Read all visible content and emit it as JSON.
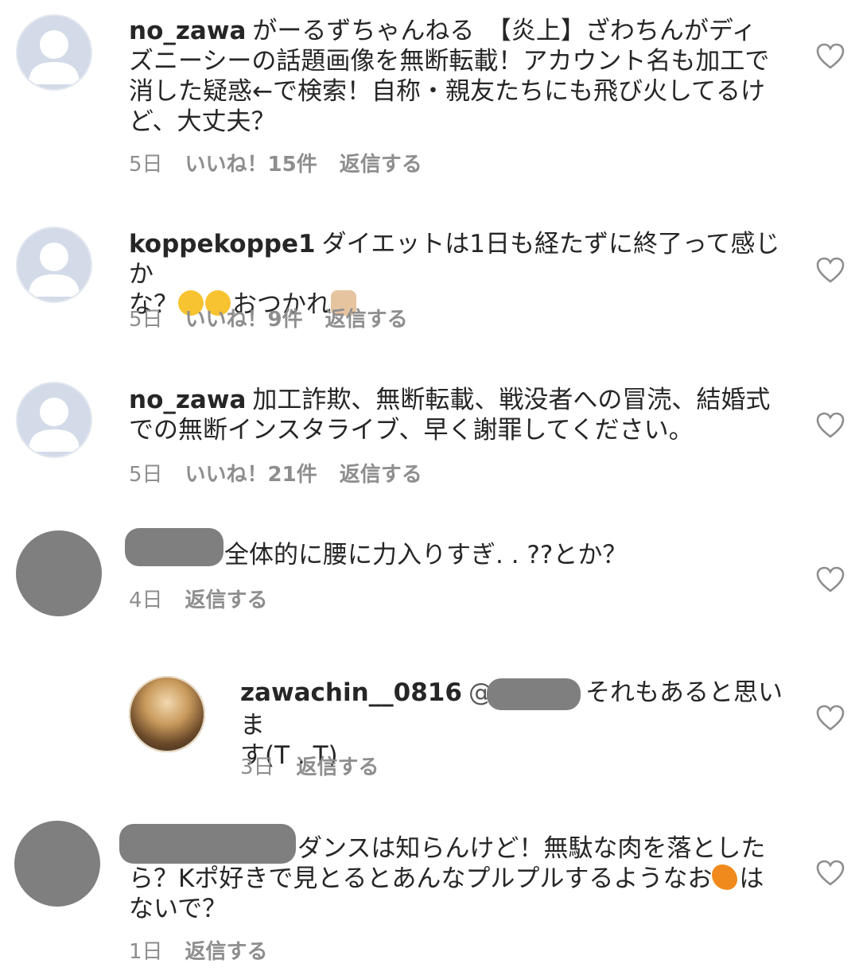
{
  "comments": [
    {
      "username": "no_zawa",
      "text_line1": "がーるずちゃんねる　【炎上】ざわちんがディ",
      "text_line2": "ズニーシーの話題画像を無断転載！アカウント名も加工で",
      "text_line3": "消した疑惑←で検索！自称・親友たちにも飛び火してるけ",
      "text_line4": "ど、大丈夫？",
      "time": "5日",
      "likes": "いいね！15件",
      "reply": "返信する"
    },
    {
      "username": "koppekoppe1",
      "text_line1": "ダイエットは1日も経たずに終了って感じか",
      "text_line2a": "な？",
      "text_line2b": "おつかれ",
      "time": "5日",
      "likes": "いいね！9件",
      "reply": "返信する"
    },
    {
      "username": "no_zawa",
      "text_line1": "加工詐欺、無断転載、戦没者への冒涜、結婚式",
      "text_line2": "での無断インスタライブ、早く謝罪してください。",
      "time": "5日",
      "likes": "いいね！21件",
      "reply": "返信する"
    },
    {
      "text_line1": "全体的に腰に力入りすぎ. . ??とか？",
      "time": "4日",
      "reply": "返信する"
    },
    {
      "username": "zawachin__0816",
      "mention_prefix": "@",
      "text_line1": "それもあると思いま",
      "text_line2": "す(T . T)",
      "time": "3日",
      "reply": "返信する"
    },
    {
      "text_line1": "ダンスは知らんけど！無駄な肉を落とした",
      "text_line2a": "ら？Kポ好きで見とるとあんなプルプルするようなお",
      "text_line2b": "は",
      "text_line3": "ないで？",
      "time": "1日",
      "reply": "返信する"
    }
  ],
  "icons": {
    "like": "heart-outline-icon",
    "avatar_default": "default-user-icon"
  },
  "colors": {
    "meta": "#8e8e8e",
    "text": "#262626",
    "redaction": "#7f7f7f"
  }
}
